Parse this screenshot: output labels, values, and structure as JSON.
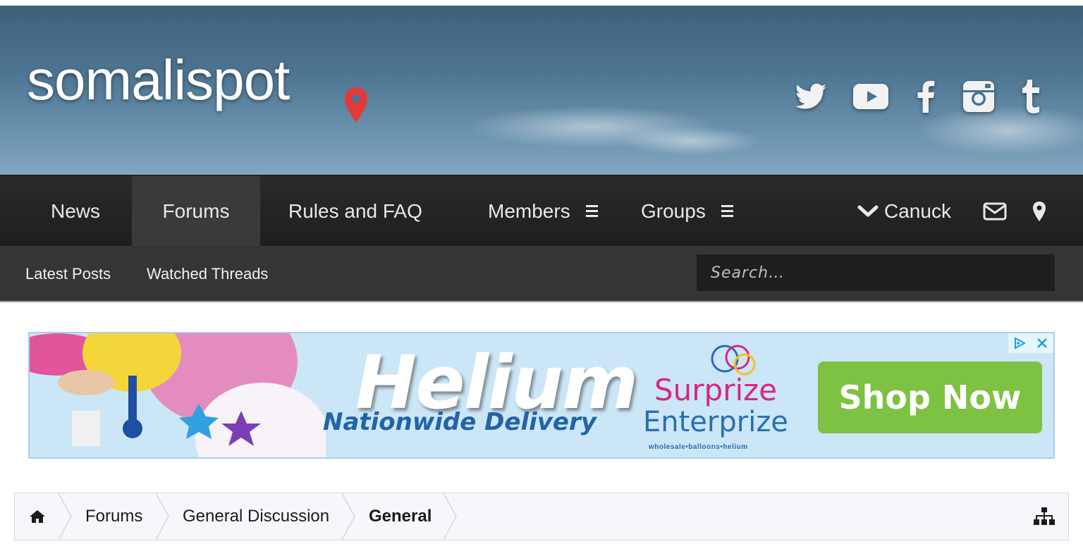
{
  "header": {
    "logo_text": "somalispot",
    "social": [
      "twitter-icon",
      "youtube-icon",
      "facebook-icon",
      "instagram-icon",
      "tumblr-icon"
    ]
  },
  "mainnav": {
    "items": [
      {
        "label": "News"
      },
      {
        "label": "Forums",
        "active": true
      },
      {
        "label": "Rules and FAQ"
      },
      {
        "label": "Members"
      },
      {
        "label": "Groups"
      }
    ],
    "user": "Canuck"
  },
  "subnav": {
    "items": [
      {
        "label": "Latest Posts"
      },
      {
        "label": "Watched Threads"
      }
    ],
    "search_placeholder": "Search…"
  },
  "ad": {
    "headline": "Helium",
    "subline": "Nationwide Delivery",
    "brand_line1": "Surprize",
    "brand_line2": "Enterprize",
    "brand_tagline": "wholesale•balloons•helium",
    "cta": "Shop Now"
  },
  "breadcrumb": {
    "items": [
      {
        "label": "Forums"
      },
      {
        "label": "General Discussion"
      },
      {
        "label": "General",
        "current": true
      }
    ]
  },
  "colors": {
    "nav_bg": "#222222",
    "nav_active": "#3a3a3a",
    "subnav_bg": "#353535",
    "cta_green": "#7dc242",
    "pin_red": "#e53935"
  }
}
